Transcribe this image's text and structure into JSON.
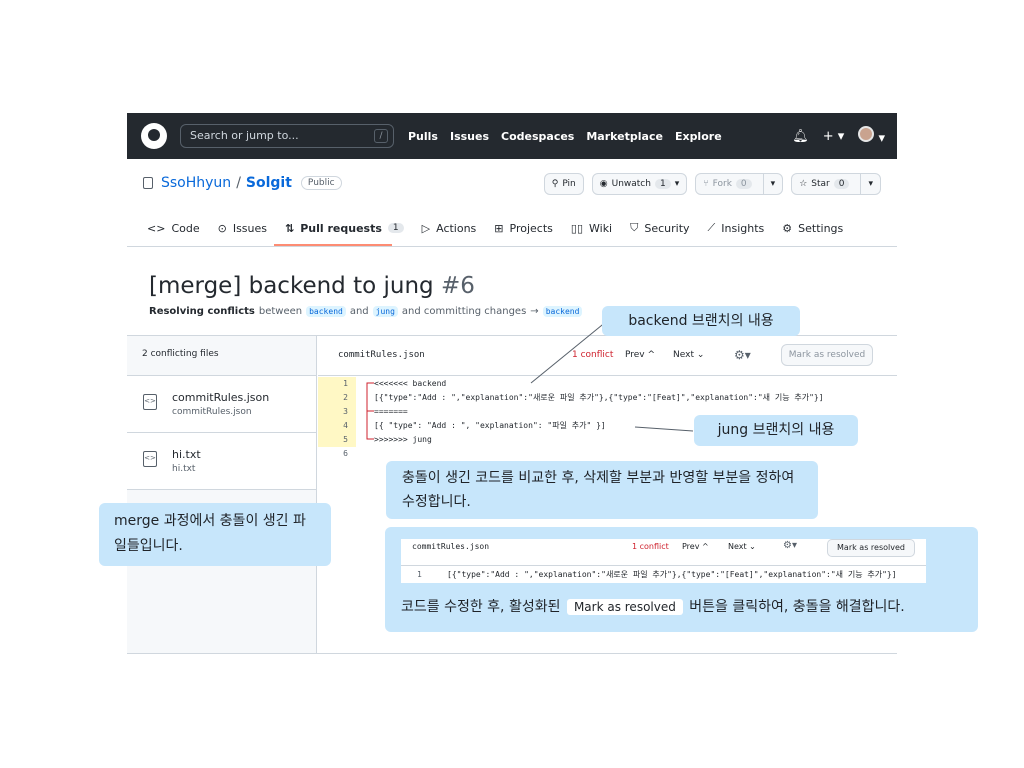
{
  "header": {
    "search_placeholder": "Search or jump to...",
    "search_shortcut": "/",
    "nav": [
      "Pulls",
      "Issues",
      "Codespaces",
      "Marketplace",
      "Explore"
    ],
    "icons": [
      "bell-icon",
      "plus-icon",
      "avatar"
    ]
  },
  "repo": {
    "owner": "SsoHhyun",
    "separator": "/",
    "name": "Solgit",
    "visibility": "Public",
    "pin_label": "Pin",
    "unwatch_label": "Unwatch",
    "unwatch_count": "1",
    "fork_label": "Fork",
    "fork_count": "0",
    "star_label": "Star",
    "star_count": "0"
  },
  "tabs": [
    {
      "label": "Code"
    },
    {
      "label": "Issues"
    },
    {
      "label": "Pull requests",
      "count": "1"
    },
    {
      "label": "Actions"
    },
    {
      "label": "Projects"
    },
    {
      "label": "Wiki"
    },
    {
      "label": "Security"
    },
    {
      "label": "Insights"
    },
    {
      "label": "Settings"
    }
  ],
  "pr": {
    "title": "[merge] backend to jung",
    "number": "#6",
    "sub_bold": "Resolving conflicts",
    "sub_between": "between",
    "branch_from": "backend",
    "sub_and": "and",
    "branch_to": "jung",
    "sub_committing": "and committing changes",
    "arrow": "→",
    "branch_target": "backend"
  },
  "files": {
    "heading": "2 conflicting files",
    "items": [
      {
        "name": "commitRules.json",
        "path": "commitRules.json"
      },
      {
        "name": "hi.txt",
        "path": "hi.txt"
      }
    ]
  },
  "editor": {
    "filename": "commitRules.json",
    "conflict": "1 conflict",
    "prev": "Prev ^",
    "next": "Next ⌄",
    "mark_resolved": "Mark as resolved",
    "lines": [
      {
        "num": "1",
        "text": "<<<<<<< backend"
      },
      {
        "num": "2",
        "text": "[{\"type\":\"Add : \",\"explanation\":\"새로운 파일 추가\"},{\"type\":\"[Feat]\",\"explanation\":\"새 기능 추가\"}]"
      },
      {
        "num": "3",
        "text": "======="
      },
      {
        "num": "4",
        "text": "[{ \"type\": \"Add : \", \"explanation\": \"파일 추가\" }]"
      },
      {
        "num": "5",
        "text": ">>>>>>> jung"
      },
      {
        "num": "6",
        "text": ""
      }
    ]
  },
  "callouts": {
    "backend": "backend 브랜치의 내용",
    "jung": "jung 브랜치의 내용",
    "compare": "충돌이 생긴 코드를 비교한 후, 삭제할 부분과 반영할 부분을 정하여 수정합니다.",
    "files": "merge 과정에서 충돌이 생긴 파일들입니다.",
    "resolve_before": "코드를 수정한 후, 활성화된",
    "resolve_button": "Mark as resolved",
    "resolve_after": "버튼을 클릭하여, 충돌을 해결합니다.",
    "mini": {
      "filename": "commitRules.json",
      "conflict": "1 conflict",
      "prev": "Prev ^",
      "next": "Next ⌄",
      "mark_resolved": "Mark as resolved",
      "line_num": "1",
      "line_text": "[{\"type\":\"Add : \",\"explanation\":\"새로운 파일 추가\"},{\"type\":\"[Feat]\",\"explanation\":\"새 기능 추가\"}]"
    }
  },
  "colors": {
    "header_bg": "#24292f",
    "accent_blue": "#0969da",
    "conflict_red": "#cf222e",
    "callout_bg": "#c7e6fb",
    "tab_underline": "#fd8c73",
    "conflict_highlight": "#fff8c5"
  }
}
